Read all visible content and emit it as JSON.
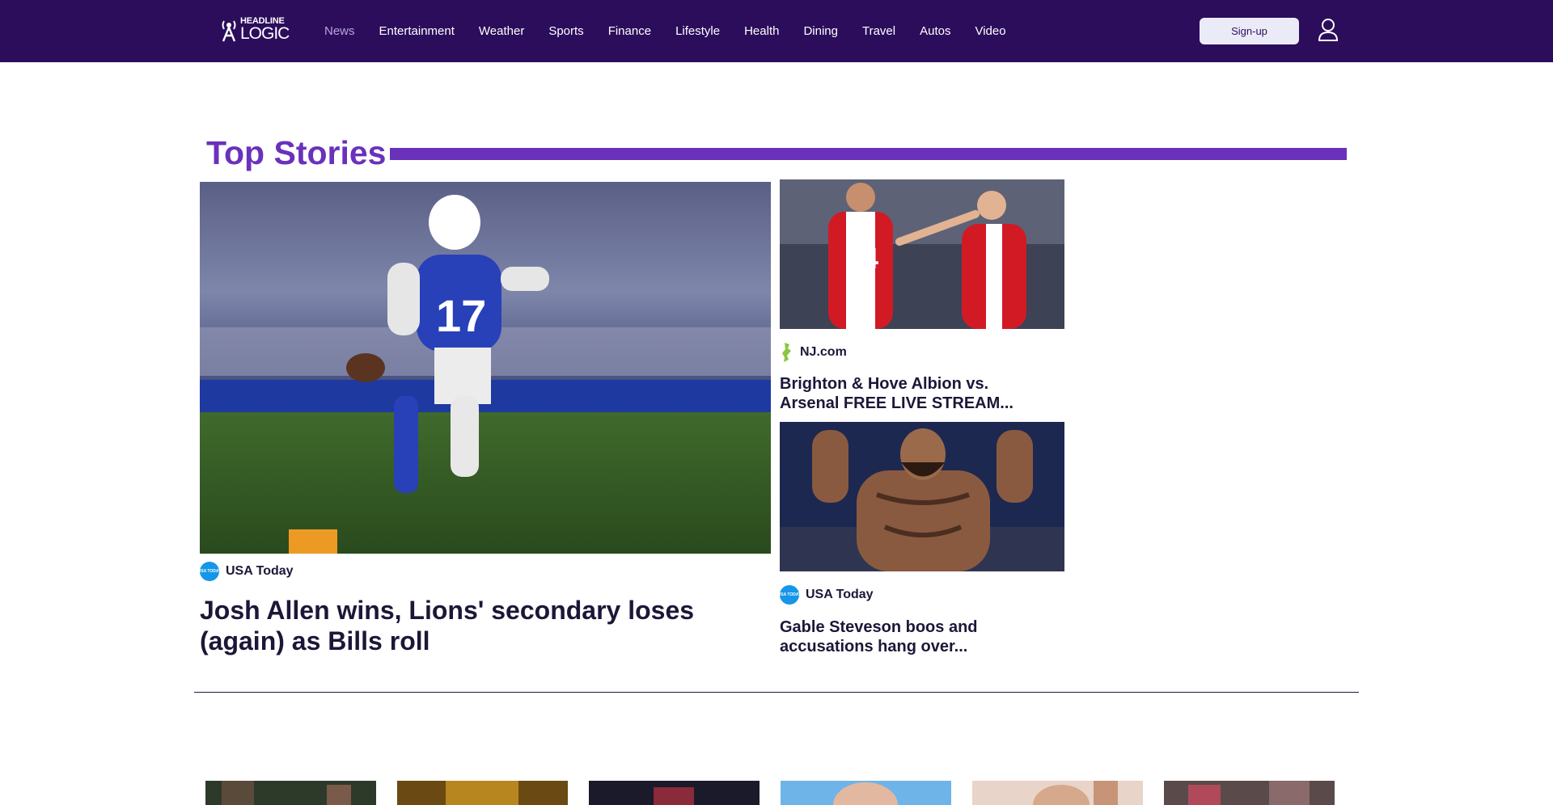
{
  "brand": {
    "name_line1": "HEADLINE",
    "name_line2": "LOGIC"
  },
  "nav": {
    "items": [
      {
        "label": "News",
        "active": true
      },
      {
        "label": "Entertainment",
        "active": false
      },
      {
        "label": "Weather",
        "active": false
      },
      {
        "label": "Sports",
        "active": false
      },
      {
        "label": "Finance",
        "active": false
      },
      {
        "label": "Lifestyle",
        "active": false
      },
      {
        "label": "Health",
        "active": false
      },
      {
        "label": "Dining",
        "active": false
      },
      {
        "label": "Travel",
        "active": false
      },
      {
        "label": "Autos",
        "active": false
      },
      {
        "label": "Video",
        "active": false
      }
    ]
  },
  "header": {
    "signup_label": "Sign-up",
    "user_icon": "user-icon"
  },
  "top_stories": {
    "title": "Top Stories",
    "main": {
      "source": "USA Today",
      "source_badge": "USA TODAY",
      "headline": "Josh Allen wins, Lions' secondary loses (again) as Bills roll",
      "image_desc": "football-player-photo"
    },
    "side": [
      {
        "source": "NJ.com",
        "headline": "Brighton & Hove Albion vs. Arsenal FREE LIVE STREAM...",
        "image_desc": "soccer-players-photo"
      },
      {
        "source": "USA Today",
        "source_badge": "USA TODAY",
        "headline": "Gable Steveson boos and accusations hang over...",
        "image_desc": "fighter-photo"
      }
    ]
  },
  "colors": {
    "header_bg": "#2c0d5c",
    "accent": "#6a31bb",
    "nav_active": "#b7a6de",
    "signup_bg": "#ebebf7",
    "text": "#1c1738",
    "usa_today_blue": "#1596e8"
  }
}
